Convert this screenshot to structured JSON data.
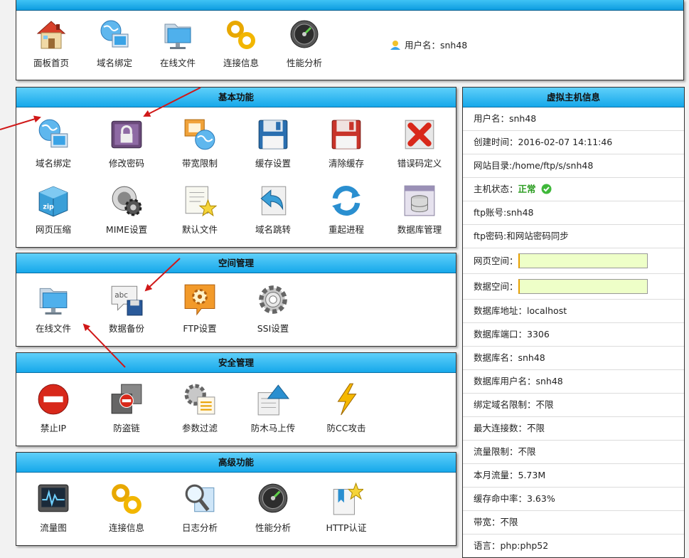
{
  "top_nav": {
    "items": [
      {
        "label": "面板首页",
        "icon": "home-icon"
      },
      {
        "label": "域名绑定",
        "icon": "domain-icon"
      },
      {
        "label": "在线文件",
        "icon": "folder-icon"
      },
      {
        "label": "连接信息",
        "icon": "chain-icon"
      },
      {
        "label": "性能分析",
        "icon": "performance-icon"
      }
    ],
    "user_label": "用户名：snh48"
  },
  "sections": {
    "basic": {
      "title": "基本功能",
      "items": [
        {
          "label": "域名绑定",
          "icon": "domain-icon"
        },
        {
          "label": "修改密码",
          "icon": "lock-icon"
        },
        {
          "label": "带宽限制",
          "icon": "bandwidth-icon"
        },
        {
          "label": "缓存设置",
          "icon": "floppy-blue-icon"
        },
        {
          "label": "清除缓存",
          "icon": "floppy-red-icon"
        },
        {
          "label": "错误码定义",
          "icon": "error-x-icon"
        },
        {
          "label": "网页压缩",
          "icon": "zip-box-icon"
        },
        {
          "label": "MIME设置",
          "icon": "mime-gear-icon"
        },
        {
          "label": "默认文件",
          "icon": "default-file-star-icon"
        },
        {
          "label": "域名跳转",
          "icon": "redirect-arrow-icon"
        },
        {
          "label": "重起进程",
          "icon": "restart-icon"
        },
        {
          "label": "数据库管理",
          "icon": "database-icon"
        }
      ]
    },
    "space": {
      "title": "空间管理",
      "items": [
        {
          "label": "在线文件",
          "icon": "folder-icon"
        },
        {
          "label": "数据备份",
          "icon": "backup-icon"
        },
        {
          "label": "FTP设置",
          "icon": "ftp-icon"
        },
        {
          "label": "SSI设置",
          "icon": "ssi-gear-icon"
        }
      ]
    },
    "security": {
      "title": "安全管理",
      "items": [
        {
          "label": "禁止IP",
          "icon": "forbid-icon"
        },
        {
          "label": "防盗链",
          "icon": "hotlink-icon"
        },
        {
          "label": "参数过滤",
          "icon": "filter-icon"
        },
        {
          "label": "防木马上传",
          "icon": "upload-shield-icon"
        },
        {
          "label": "防CC攻击",
          "icon": "lightning-icon"
        }
      ]
    },
    "advanced": {
      "title": "高级功能",
      "items": [
        {
          "label": "流量图",
          "icon": "traffic-chart-icon"
        },
        {
          "label": "连接信息",
          "icon": "chain-icon"
        },
        {
          "label": "日志分析",
          "icon": "log-magnifier-icon"
        },
        {
          "label": "性能分析",
          "icon": "performance-icon"
        },
        {
          "label": "HTTP认证",
          "icon": "http-auth-icon"
        }
      ]
    }
  },
  "host_info": {
    "title": "虚拟主机信息",
    "username": "用户名：snh48",
    "created": "创建时间：2016-02-07 14:11:46",
    "site_dir": "网站目录:/home/ftp/s/snh48",
    "status_label": "主机状态：",
    "status_value": "正常",
    "ftp_account": "ftp账号:snh48",
    "ftp_password": "ftp密码:和网站密码同步",
    "web_space_label": "网页空间：",
    "data_space_label": "数据空间：",
    "db_host": "数据库地址：localhost",
    "db_port": "数据库端口：3306",
    "db_name": "数据库名：snh48",
    "db_user": "数据库用户名：snh48",
    "domain_limit": "绑定域名限制：不限",
    "max_conn": "最大连接数：不限",
    "traffic_limit": "流量限制：不限",
    "month_traffic": "本月流量：5.73M",
    "cache_hit": "缓存命中率：3.63%",
    "bandwidth": "带宽：不限",
    "language": "语言：php:php52"
  },
  "colors": {
    "header_blue": "#16a8ea",
    "status_green": "#2a9c1f",
    "annotation_red": "#d01818",
    "meter_fill": "#eeffc8"
  }
}
